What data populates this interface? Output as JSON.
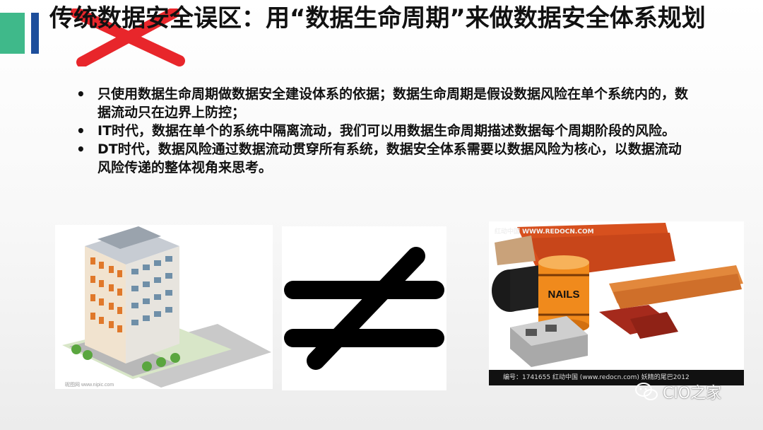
{
  "title": "传统数据安全误区：用“数据生命周期”来做数据安全体系规划",
  "bullets": [
    "只使用数据生命周期做数据安全建设体系的依据；数据生命周期是假设数据风险在单个系统内的，数据流动只在边界上防控；",
    "IT时代，数据在单个的系统中隔离流动，我们可以用数据生命周期描述数据每个周期阶段的风险。",
    "DT时代，数据风险通过数据流动贯穿所有系统，数据安全体系需要以数据风险为核心，以数据流动风险传递的整体视角来思考。"
  ],
  "images": {
    "building_watermark": "昵图网 www.nipic.com",
    "materials_watermark": "红动中国 WWW.REDOCN.COM",
    "materials_footer": "编号：1741655   红动中国 (www.redocn.com)   妖精的尾巴2012",
    "barrel_label": "NAILS"
  },
  "brand": {
    "name": "CIO之家"
  },
  "icons": [
    "red-x-icon",
    "not-equal-icon",
    "wechat-icon"
  ],
  "colors": {
    "teal": "#3fb98a",
    "navy": "#1d4e9b",
    "red": "#e8262b",
    "text": "#111111"
  }
}
